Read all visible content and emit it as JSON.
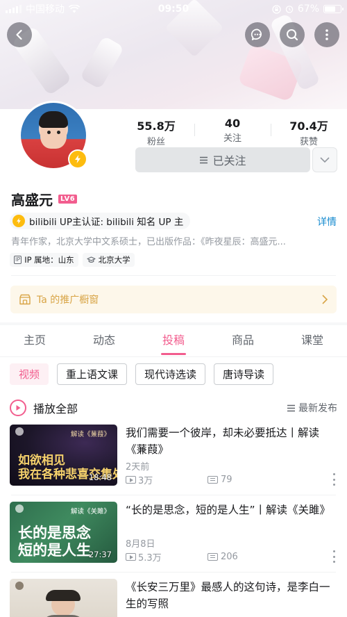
{
  "status": {
    "carrier": "中国移动",
    "time": "09:50",
    "battery": "67%",
    "battery_level": 0.67
  },
  "profile": {
    "fans_count": "55.8万",
    "fans_label": "粉丝",
    "following_count": "40",
    "following_label": "关注",
    "likes_count": "70.4万",
    "likes_label": "获赞",
    "follow_button_label": "已关注",
    "name": "高盛元",
    "level_badge": "LV6",
    "verification": "bilibili UP主认证: bilibili 知名 UP 主",
    "detail_link": "详情",
    "bio": "青年作家，北京大学中文系硕士，已出版作品：《昨夜星辰：高盛元...",
    "ip_tag_icon": "IP",
    "ip_location": "IP 属地：山东",
    "school": "北京大学",
    "shop_window_label": "Ta 的推广橱窗"
  },
  "tabs": [
    "主页",
    "动态",
    "投稿",
    "商品",
    "课堂"
  ],
  "active_tab": "投稿",
  "chips": [
    "视频",
    "重上语文课",
    "现代诗选读",
    "唐诗导读"
  ],
  "active_chip": "视频",
  "list_header": {
    "play_all": "播放全部",
    "sort": "最新发布"
  },
  "videos": [
    {
      "title": "我们需要一个彼岸，却未必要抵达丨解读《蒹葭》",
      "date": "2天前",
      "views": "3万",
      "danmaku": "79",
      "duration": "18:48",
      "thumb_subtitle": "解读《蒹葭》",
      "thumb_text": "如欲相见\n我在各种悲喜交集处"
    },
    {
      "title": "“长的是思念，短的是人生”丨解读《关雎》",
      "date": "8月8日",
      "views": "5.3万",
      "danmaku": "206",
      "duration": "27:37",
      "thumb_subtitle": "解读《关雎》",
      "thumb_text": "长的是思念\n短的是人生"
    },
    {
      "title": "《长安三万里》最感人的这句诗，是李白一生的写照",
      "date": "",
      "views": "",
      "danmaku": "",
      "duration": "",
      "thumb_subtitle": "",
      "thumb_text": ""
    }
  ],
  "colors": {
    "accent": "#f25d8e",
    "link": "#178bcf",
    "up_badge": "#fdbc0f",
    "shop_text": "#d8a445"
  }
}
